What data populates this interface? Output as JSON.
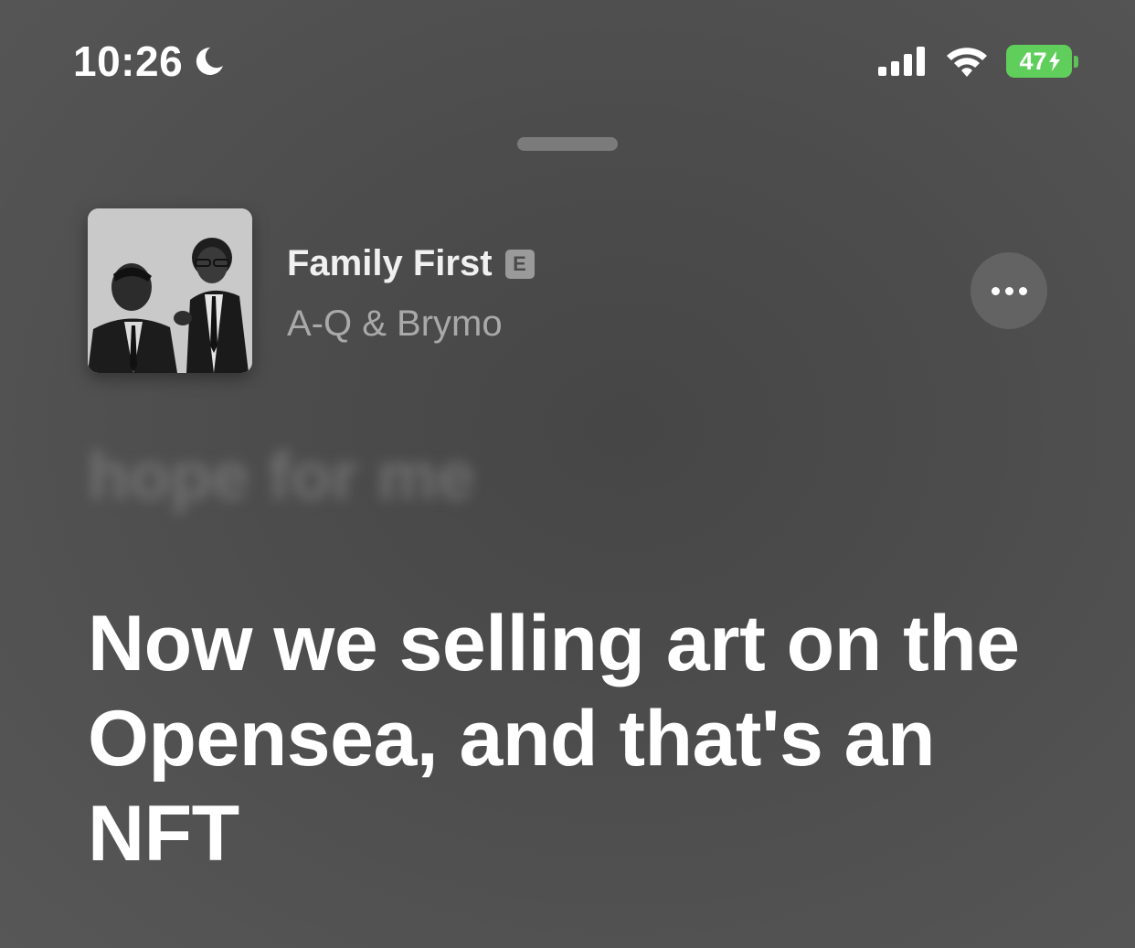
{
  "status_bar": {
    "time": "10:26",
    "battery_percent": "47",
    "colors": {
      "battery": "#5fce5a"
    },
    "icons": [
      "moon-icon",
      "signal-icon",
      "wifi-icon",
      "charging-bolt-icon"
    ]
  },
  "now_playing": {
    "title": "Family First",
    "explicit_badge": "E",
    "artist": "A-Q & Brymo",
    "more_button_icon": "ellipsis-icon"
  },
  "lyrics": {
    "past_lines": [
      "",
      "hope for me"
    ],
    "current_line": "Now we selling art on the Opensea, and that's an NFT"
  },
  "colors": {
    "background": "#4c4c4c",
    "primary_text": "#ffffff",
    "secondary_text": "#a9a9a9"
  }
}
